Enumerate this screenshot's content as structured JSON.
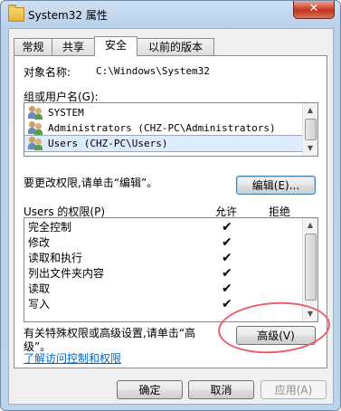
{
  "window": {
    "title": "System32 属性",
    "close_glyph": "✕",
    "folder_icon": "folder-icon"
  },
  "tabs": [
    {
      "label": "常规",
      "active": false
    },
    {
      "label": "共享",
      "active": false
    },
    {
      "label": "安全",
      "active": true
    },
    {
      "label": "以前的版本",
      "active": false
    }
  ],
  "security": {
    "object_name_label": "对象名称:",
    "object_name_value": "C:\\Windows\\System32",
    "group_label": "组或用户名(G):",
    "users": [
      {
        "name": "SYSTEM",
        "selected": false
      },
      {
        "name": "Administrators (CHZ-PC\\Administrators)",
        "selected": false
      },
      {
        "name": "Users (CHZ-PC\\Users)",
        "selected": true
      }
    ],
    "edit_hint": "要更改权限,请单击“编辑”。",
    "edit_button": "编辑(E)...",
    "perm_label": "Users 的权限(P)",
    "allow_header": "允许",
    "deny_header": "拒绝",
    "check_glyph": "✔",
    "permissions": [
      {
        "name": "完全控制",
        "allow": true,
        "deny": false
      },
      {
        "name": "修改",
        "allow": true,
        "deny": false
      },
      {
        "name": "读取和执行",
        "allow": true,
        "deny": false
      },
      {
        "name": "列出文件夹内容",
        "allow": true,
        "deny": false
      },
      {
        "name": "读取",
        "allow": true,
        "deny": false
      },
      {
        "name": "写入",
        "allow": true,
        "deny": false
      }
    ],
    "advanced_hint_line1": "有关特殊权限或高级设置,请单击“高",
    "advanced_hint_line2": "级”。",
    "advanced_button": "高级(V)",
    "learn_link": "了解访问控制和权限"
  },
  "footer": {
    "ok": "确定",
    "cancel": "取消",
    "apply": "应用(A)"
  },
  "colors": {
    "annotation": "#e8606a",
    "link": "#0066cc",
    "selection": "#dcecfc"
  }
}
